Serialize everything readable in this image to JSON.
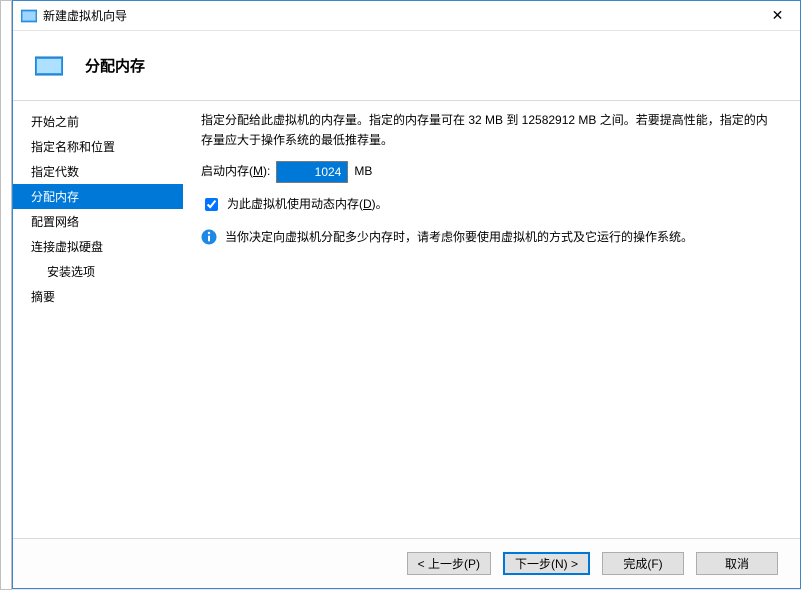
{
  "window": {
    "title": "新建虚拟机向导",
    "close_glyph": "✕"
  },
  "header": {
    "title": "分配内存"
  },
  "sidebar": {
    "items": [
      {
        "label": "开始之前"
      },
      {
        "label": "指定名称和位置"
      },
      {
        "label": "指定代数"
      },
      {
        "label": "分配内存"
      },
      {
        "label": "配置网络"
      },
      {
        "label": "连接虚拟硬盘"
      },
      {
        "label": "安装选项"
      },
      {
        "label": "摘要"
      }
    ],
    "selected_index": 3
  },
  "content": {
    "description": "指定分配给此虚拟机的内存量。指定的内存量可在 32 MB 到 12582912 MB 之间。若要提高性能，指定的内存量应大于操作系统的最低推荐量。",
    "mem_label_pre": "启动内存(",
    "mem_label_key": "M",
    "mem_label_post": "):",
    "mem_value": "1024",
    "mem_unit": "MB",
    "dyn_checked": true,
    "dyn_label_pre": "为此虚拟机使用动态内存(",
    "dyn_label_key": "D",
    "dyn_label_post": ")。",
    "info_text": "当你决定向虚拟机分配多少内存时，请考虑你要使用虚拟机的方式及它运行的操作系统。"
  },
  "footer": {
    "prev": "< 上一步(P)",
    "next": "下一步(N) >",
    "finish": "完成(F)",
    "cancel": "取消"
  }
}
